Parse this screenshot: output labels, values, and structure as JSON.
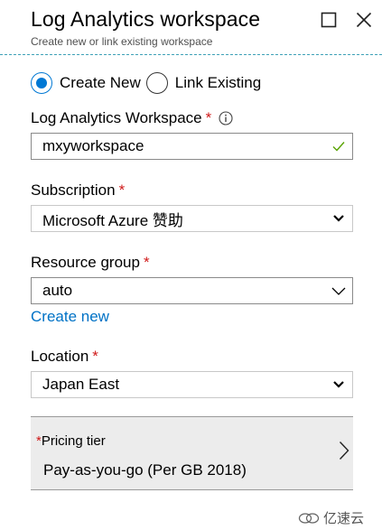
{
  "header": {
    "title": "Log Analytics workspace",
    "subtitle": "Create new or link existing workspace"
  },
  "mode": {
    "options": [
      {
        "label": "Create New",
        "selected": true
      },
      {
        "label": "Link Existing",
        "selected": false
      }
    ]
  },
  "workspace": {
    "label": "Log Analytics Workspace",
    "required": "*",
    "value": "mxyworkspace",
    "info_icon": "info-icon",
    "valid_icon": "checkmark-icon"
  },
  "subscription": {
    "label": "Subscription",
    "required": "*",
    "value": "Microsoft Azure 赞助"
  },
  "resource_group": {
    "label": "Resource group",
    "required": "*",
    "value": "auto",
    "create_new_link": "Create new"
  },
  "location": {
    "label": "Location",
    "required": "*",
    "value": "Japan East"
  },
  "pricing": {
    "required": "*",
    "label": "Pricing tier",
    "value": "Pay-as-you-go (Per GB 2018)"
  },
  "watermark": {
    "text": "亿速云"
  },
  "colors": {
    "accent": "#0078d4",
    "link": "#0072c6",
    "required": "#d01a1a",
    "valid": "#57a300",
    "header_divider": "#3ea1b8"
  }
}
